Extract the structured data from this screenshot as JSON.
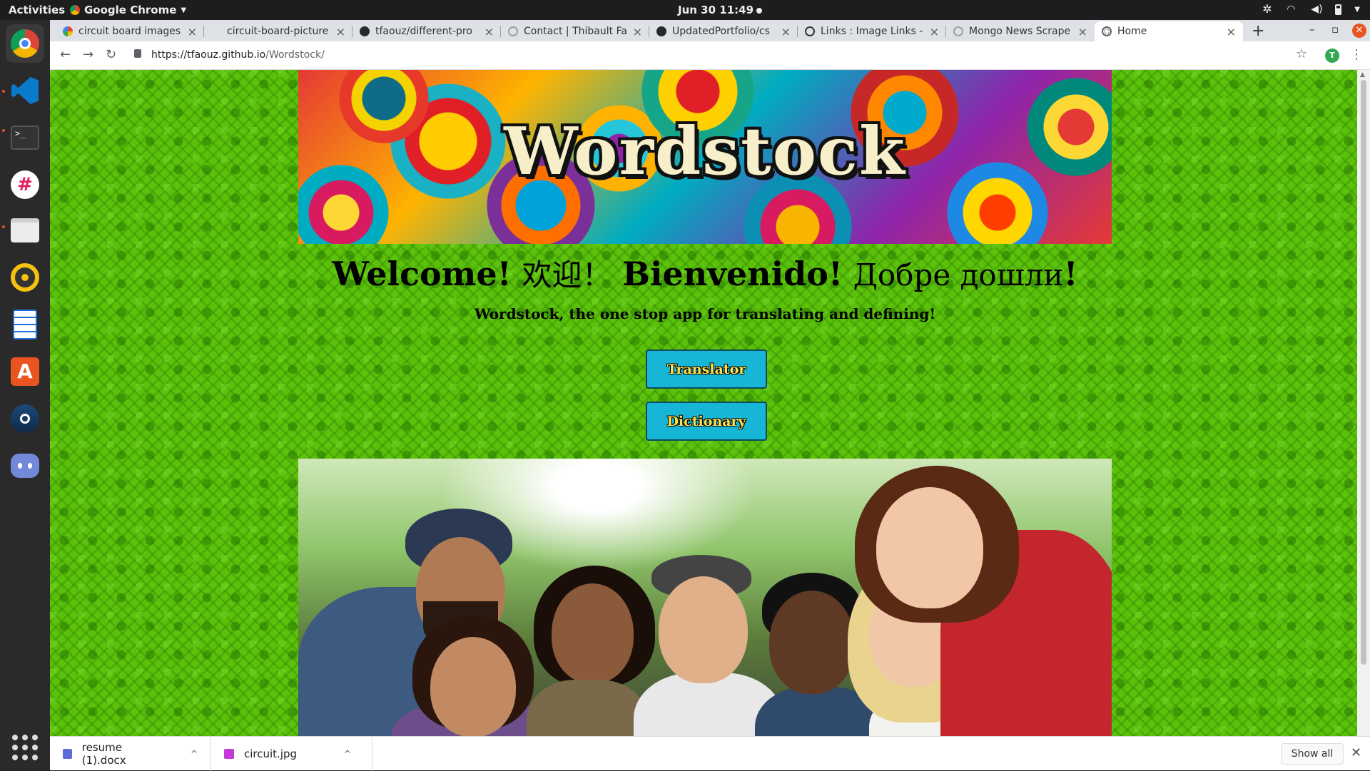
{
  "topbar": {
    "activities": "Activities",
    "app_name": "Google Chrome",
    "clock": "Jun 30  11:49"
  },
  "dock": {
    "items": [
      "chrome-icon",
      "vscode-icon",
      "terminal-icon",
      "slack-icon",
      "files-icon",
      "rhythmbox-icon",
      "writer-icon",
      "software-icon",
      "steam-icon",
      "discord-icon"
    ]
  },
  "browser": {
    "tabs": [
      {
        "title": "circuit board images",
        "favicon": "google-icon"
      },
      {
        "title": "circuit-board-picture",
        "favicon": "blank-icon"
      },
      {
        "title": "tfaouz/different-pro",
        "favicon": "github-icon"
      },
      {
        "title": "Contact | Thibault Fa",
        "favicon": "spinner-icon"
      },
      {
        "title": "UpdatedPortfolio/cs",
        "favicon": "github-icon"
      },
      {
        "title": "Links : Image Links - I",
        "favicon": "links-icon"
      },
      {
        "title": "Mongo News Scrape",
        "favicon": "spinner-icon"
      },
      {
        "title": "Home",
        "favicon": "globe-icon"
      }
    ],
    "url_host": "https://tfaouz.github.io",
    "url_path": "/Wordstock/",
    "profile_initial": "T"
  },
  "page": {
    "banner_title": "Wordstock",
    "welcome_en": "Welcome!",
    "welcome_zh": "欢迎！",
    "welcome_es": "Bienvenido!",
    "welcome_ru": "Добре дошли",
    "welcome_ru_excl": "!",
    "subtitle": "Wordstock, the one stop app for translating and defining!",
    "buttons": {
      "translator": "Translator",
      "dictionary": "Dictionary"
    }
  },
  "downloads": {
    "items": [
      {
        "name": "resume (1).docx",
        "color": "#5b6bd8"
      },
      {
        "name": "circuit.jpg",
        "color": "#c23bd4"
      }
    ],
    "show_all": "Show all"
  },
  "colors": {
    "page_background": "#5cc10a",
    "button_bg": "#17b5d6",
    "button_text": "#ffe14d",
    "title_fill": "#f7efc9"
  }
}
